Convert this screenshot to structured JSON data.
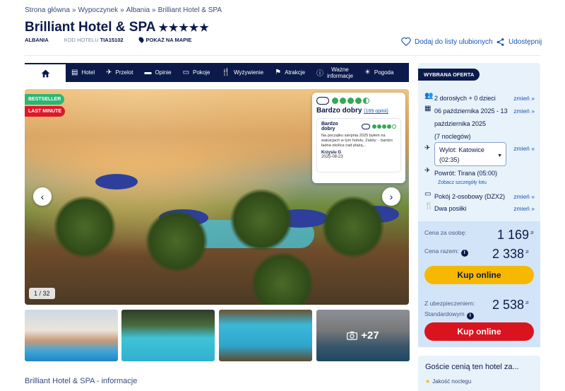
{
  "breadcrumb": {
    "items": [
      "Strona główna",
      "Wypoczynek",
      "Albania",
      "Brilliant Hotel & SPA"
    ],
    "sep": "»"
  },
  "hotel": {
    "name": "Brilliant Hotel & SPA",
    "stars": "★★★★★",
    "country": "ALBANIA",
    "code_label": "KOD HOTELU",
    "code": "TIA15102",
    "map_label": "POKAŻ NA MAPIE",
    "fav_label": "Dodaj do listy ulubionych",
    "share_label": "Udostępnij"
  },
  "nav": {
    "items": [
      "Hotel",
      "Przelot",
      "Opinie",
      "Pokoje",
      "Wyżywienie",
      "Atrakcje",
      "Ważne informacje",
      "Pogoda"
    ],
    "important_line1": "Ważne",
    "important_line2": "informacje"
  },
  "gallery": {
    "badge_bestseller": "BESTSELLER",
    "badge_last_minute": "LAST MINUTE",
    "counter": "1 / 32",
    "more_photos": "+27",
    "prev_icon": "chevron-left-icon",
    "next_icon": "chevron-right-icon"
  },
  "review": {
    "rating_dots": 4.5,
    "summary": "Bardzo dobry",
    "count_link": "(169 opinii)",
    "item": {
      "title_line1": "Bardzo",
      "title_line2": "dobry",
      "dots": 4,
      "text": "Na początku sierpnia 2025 byłem na wakacjach w tym hotelu. Zalety: - bardzo ładna okolica nad plażą...",
      "author": "Krzysiu G",
      "date": "2025-08-23"
    }
  },
  "info_heading": "Brilliant Hotel & SPA - informacje",
  "offer": {
    "header": "WYBRANA OFERTA",
    "people": "2 dorosłych + 0 dzieci",
    "dates_line1": "06 października 2025 - 13",
    "dates_line2": "października 2025",
    "nights": "(7 noclegów)",
    "departure": "Wylot: Katowice (02:35)",
    "departure_line1": "Wylot: Katowice",
    "departure_line2": "(02:35)",
    "return": "Powrót: Tirana (05:00)",
    "flight_details": "Zobacz szczegóły lotu",
    "room": "Pokój 2-osobowy (DZX2)",
    "board": "Dwa posiłki",
    "change": "zmień »",
    "price_per_person_label": "Cena za osobę:",
    "price_per_person": "1 169",
    "total_label": "Cena razem:",
    "total": "2 338",
    "currency": "zł",
    "buy_label": "Kup online",
    "insurance_label_line1": "Z ubezpieczeniem:",
    "insurance_label_line2": "Standardowym",
    "insurance_total": "2 538",
    "buy_label_2": "Kup online"
  },
  "guests": {
    "heading": "Goście cenią ten hotel za...",
    "first": "Jakość noclegu"
  },
  "colors": {
    "navy": "#0b1a4a",
    "link": "#1a55b8",
    "yellow": "#f6b800",
    "red": "#d9141f",
    "green": "#2bb673"
  }
}
